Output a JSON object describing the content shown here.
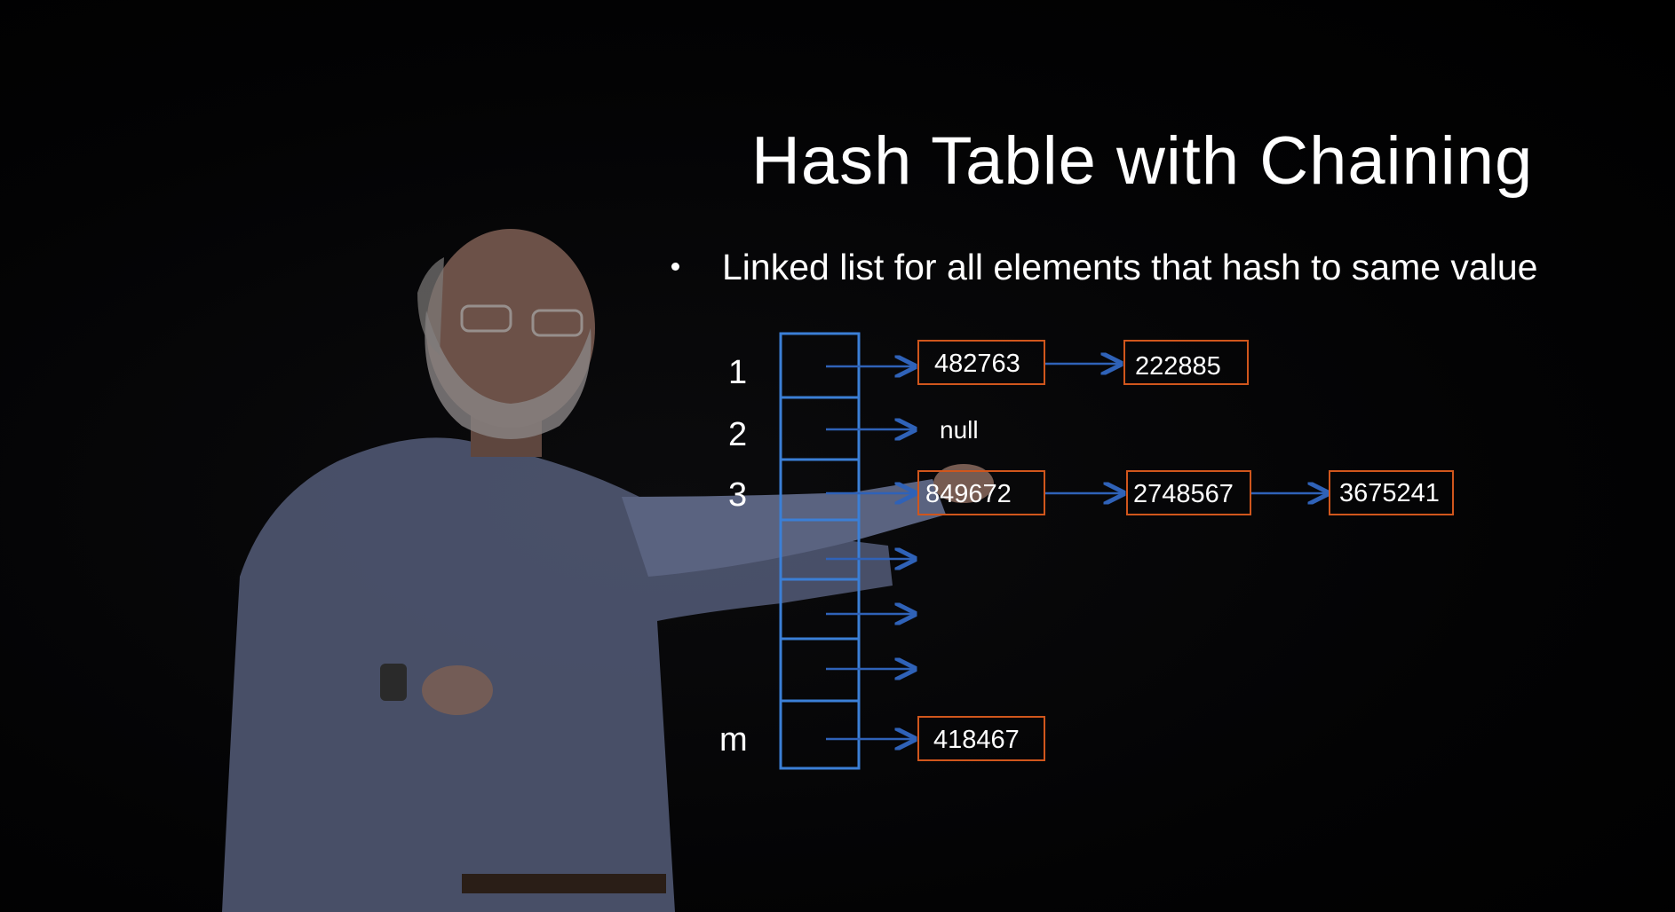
{
  "slide": {
    "title": "Hash Table with Chaining",
    "bullet": "Linked list for all elements that hash to same value"
  },
  "diagram": {
    "slot_labels": [
      "1",
      "2",
      "3",
      "",
      "",
      "",
      "m"
    ],
    "chains": [
      {
        "slot": "1",
        "values": [
          "482763",
          "222885"
        ]
      },
      {
        "slot": "2",
        "null_text": "null"
      },
      {
        "slot": "3",
        "values": [
          "849672",
          "2748567",
          "3675241"
        ]
      },
      {
        "slot": "m",
        "values": [
          "418467"
        ]
      }
    ]
  },
  "colors": {
    "background": "#000000",
    "table_border": "#3b7fd6",
    "node_border": "#d0561c",
    "arrow": "#2f62b8",
    "text": "#ffffff"
  }
}
